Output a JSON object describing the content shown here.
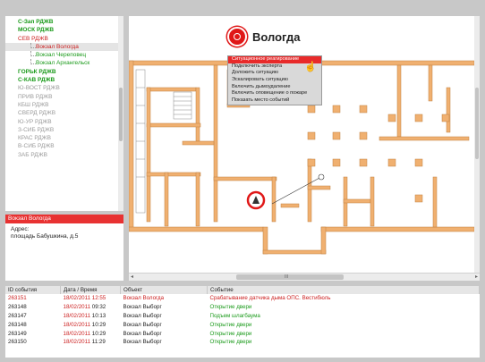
{
  "tree": {
    "items": [
      {
        "label": "С-Зап РДЖВ",
        "style": "green",
        "level": 0
      },
      {
        "label": "МОСК РДЖВ",
        "style": "green",
        "level": 0
      },
      {
        "label": "СЕВ РДЖВ",
        "style": "red",
        "level": 0
      },
      {
        "label": "Вокзал Вологда",
        "style": "red selected",
        "level": 1
      },
      {
        "label": "Вокзал Череповец",
        "style": "child",
        "level": 1
      },
      {
        "label": "Вокзал Архангельск",
        "style": "child",
        "level": 1
      },
      {
        "label": "ГОРЬК РДЖВ",
        "style": "green",
        "level": 0
      },
      {
        "label": "С-КАВ РДЖВ",
        "style": "green",
        "level": 0
      },
      {
        "label": "Ю-ВОСТ РДЖВ",
        "style": "gray",
        "level": 0
      },
      {
        "label": "ПРИВ РДЖВ",
        "style": "gray",
        "level": 0
      },
      {
        "label": "КБШ РДЖВ",
        "style": "gray",
        "level": 0
      },
      {
        "label": "СВЕРД РДЖВ",
        "style": "gray",
        "level": 0
      },
      {
        "label": "Ю-УР РДЖВ",
        "style": "gray",
        "level": 0
      },
      {
        "label": "З-СИБ РДЖВ",
        "style": "gray",
        "level": 0
      },
      {
        "label": "КРАС РДЖВ",
        "style": "gray",
        "level": 0
      },
      {
        "label": "В-СИБ РДЖВ",
        "style": "gray",
        "level": 0
      },
      {
        "label": "ЗАБ РДЖВ",
        "style": "gray",
        "level": 0
      }
    ]
  },
  "address": {
    "header": "Вокзал Вологда",
    "label": "Адрес:",
    "value": "площадь Бабушкина, д.5"
  },
  "map": {
    "title": "Вологда",
    "menu": [
      "Ситуационное реагирование",
      "Подключить эксперта",
      "Доложить ситуацию",
      "Эскалировать ситуацию",
      "Включить дымоудаление",
      "Включить оповещение о пожаре",
      "Показать место событий"
    ],
    "active_menu_index": 0,
    "scroll_label": "III"
  },
  "events": {
    "columns": [
      "ID события",
      "Дата / Время",
      "Объект",
      "Событие"
    ],
    "rows": [
      {
        "id": "263151",
        "date": "18/02/2011",
        "time": "12:55",
        "object": "Вокзал Вологда",
        "event": "Срабатывание датчика дыма ОПС. Вестибюль",
        "alarm": true
      },
      {
        "id": "263148",
        "date": "18/02/2011",
        "time": "09:32",
        "object": "Вокзал Выборг",
        "event": "Открытие двери",
        "alarm": false
      },
      {
        "id": "263147",
        "date": "18/02/2011",
        "time": "10:13",
        "object": "Вокзал Выборг",
        "event": "Подъем шлагбаума",
        "alarm": false
      },
      {
        "id": "263148",
        "date": "18/02/2011",
        "time": "10:29",
        "object": "Вокзал Выборг",
        "event": "Открытие двери",
        "alarm": false
      },
      {
        "id": "263149",
        "date": "18/02/2011",
        "time": "10:29",
        "object": "Вокзал Выборг",
        "event": "Открытие двери",
        "alarm": false
      },
      {
        "id": "263150",
        "date": "18/02/2011",
        "time": "11:29",
        "object": "Вокзал Выборг",
        "event": "Открытие двери",
        "alarm": false
      }
    ]
  },
  "colors": {
    "alarm": "#cc2020",
    "ok": "#1a9a1a",
    "wall": "#f0b070",
    "background": "#c8c8c8"
  }
}
